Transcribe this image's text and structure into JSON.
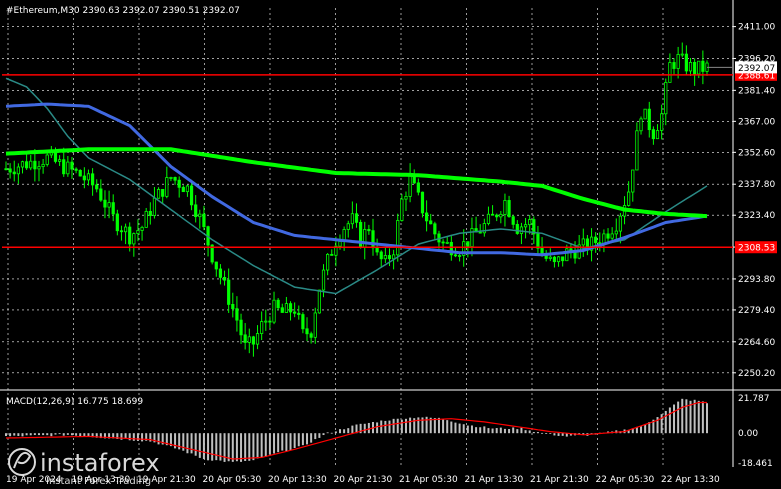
{
  "header": {
    "symbol_line": "#Ethereum,M30  2390.63 2392.07 2390.51 2392.07",
    "macd_line": "MACD(12,26,9) 16.775 18.699"
  },
  "watermark": {
    "brand": "instaforex",
    "tagline": "Instant Forex Trading"
  },
  "colors": {
    "background": "#000000",
    "grid": "#ffffff",
    "bull": "#00ff00",
    "bear": "#00ff00",
    "ma_fast": "#2a8a86",
    "ma_mid": "#4169e1",
    "ma_slow": "#00ff00",
    "level": "#ff0000",
    "macd_hist": "#c0c0c0",
    "macd_signal": "#ff0000"
  },
  "chart_data": [
    {
      "type": "candlestick",
      "price_axis": {
        "ticks": [
          "2411.00",
          "2396.20",
          "2381.40",
          "2367.00",
          "2352.60",
          "2337.80",
          "2323.40",
          "2308.60",
          "2293.80",
          "2279.40",
          "2264.60",
          "2250.20"
        ],
        "ylim": [
          2245,
          2415
        ]
      },
      "time_axis": {
        "ticks": [
          "19 Apr 2024",
          "19 Apr 13:30",
          "19 Apr 21:30",
          "20 Apr 05:30",
          "20 Apr 13:30",
          "20 Apr 21:30",
          "21 Apr 05:30",
          "21 Apr 13:30",
          "21 Apr 21:30",
          "22 Apr 05:30",
          "22 Apr 13:30"
        ]
      },
      "current_price": {
        "label": "2392.07",
        "value": 2392.07
      },
      "levels": [
        {
          "label": "2388.61",
          "value": 2388.61
        },
        {
          "label": "2308.53",
          "value": 2308.53
        }
      ],
      "close_path": [
        [
          0,
          2345
        ],
        [
          6,
          2348
        ],
        [
          10,
          2350
        ],
        [
          14,
          2346
        ],
        [
          18,
          2342
        ],
        [
          22,
          2336
        ],
        [
          26,
          2322
        ],
        [
          30,
          2314
        ],
        [
          33,
          2318
        ],
        [
          36,
          2330
        ],
        [
          40,
          2341
        ],
        [
          44,
          2336
        ],
        [
          47,
          2322
        ],
        [
          50,
          2305
        ],
        [
          53,
          2290
        ],
        [
          56,
          2275
        ],
        [
          58,
          2262
        ],
        [
          60,
          2264
        ],
        [
          62,
          2272
        ],
        [
          65,
          2280
        ],
        [
          67,
          2278
        ],
        [
          70,
          2280
        ],
        [
          72,
          2268
        ],
        [
          74,
          2270
        ],
        [
          76,
          2290
        ],
        [
          78,
          2302
        ],
        [
          80,
          2312
        ],
        [
          82,
          2318
        ],
        [
          84,
          2321
        ],
        [
          86,
          2312
        ],
        [
          88,
          2318
        ],
        [
          90,
          2304
        ],
        [
          92,
          2301
        ],
        [
          94,
          2308
        ],
        [
          96,
          2330
        ],
        [
          98,
          2340
        ],
        [
          100,
          2331
        ],
        [
          102,
          2322
        ],
        [
          104,
          2315
        ],
        [
          106,
          2310
        ],
        [
          110,
          2308
        ],
        [
          114,
          2315
        ],
        [
          118,
          2322
        ],
        [
          121,
          2330
        ],
        [
          124,
          2318
        ],
        [
          127,
          2320
        ],
        [
          130,
          2305
        ],
        [
          133,
          2300
        ],
        [
          136,
          2306
        ],
        [
          139,
          2308
        ],
        [
          142,
          2310
        ],
        [
          145,
          2314
        ],
        [
          148,
          2320
        ],
        [
          151,
          2335
        ],
        [
          154,
          2372
        ],
        [
          157,
          2362
        ],
        [
          159,
          2370
        ],
        [
          161,
          2393
        ],
        [
          163,
          2396
        ],
        [
          165,
          2393
        ],
        [
          167,
          2391
        ],
        [
          170,
          2392
        ]
      ],
      "ma_slow_path": [
        [
          0,
          2352
        ],
        [
          20,
          2354
        ],
        [
          40,
          2354
        ],
        [
          60,
          2348
        ],
        [
          80,
          2343
        ],
        [
          100,
          2342
        ],
        [
          120,
          2339
        ],
        [
          130,
          2337
        ],
        [
          140,
          2331
        ],
        [
          150,
          2326
        ],
        [
          160,
          2324
        ],
        [
          170,
          2323
        ]
      ],
      "ma_mid_path": [
        [
          0,
          2374
        ],
        [
          10,
          2375
        ],
        [
          20,
          2374
        ],
        [
          30,
          2365
        ],
        [
          40,
          2346
        ],
        [
          50,
          2332
        ],
        [
          60,
          2320
        ],
        [
          70,
          2314
        ],
        [
          80,
          2312
        ],
        [
          90,
          2310
        ],
        [
          100,
          2308
        ],
        [
          110,
          2306
        ],
        [
          120,
          2306
        ],
        [
          130,
          2305
        ],
        [
          140,
          2307
        ],
        [
          150,
          2313
        ],
        [
          160,
          2320
        ],
        [
          170,
          2323
        ]
      ],
      "ma_fast_path": [
        [
          0,
          2387
        ],
        [
          5,
          2383
        ],
        [
          10,
          2373
        ],
        [
          15,
          2360
        ],
        [
          20,
          2350
        ],
        [
          30,
          2340
        ],
        [
          40,
          2326
        ],
        [
          50,
          2312
        ],
        [
          60,
          2300
        ],
        [
          70,
          2290
        ],
        [
          80,
          2287
        ],
        [
          90,
          2298
        ],
        [
          100,
          2310
        ],
        [
          110,
          2315
        ],
        [
          120,
          2317
        ],
        [
          130,
          2315
        ],
        [
          140,
          2308
        ],
        [
          150,
          2312
        ],
        [
          160,
          2325
        ],
        [
          170,
          2337
        ]
      ],
      "macd": {
        "ticks": [
          "21.787",
          "0.00",
          "-18.461"
        ],
        "ylim": [
          -18.461,
          21.787
        ],
        "histogram_path": [
          [
            0,
            -2
          ],
          [
            15,
            -1
          ],
          [
            25,
            -3
          ],
          [
            35,
            -5
          ],
          [
            42,
            -10
          ],
          [
            48,
            -16
          ],
          [
            55,
            -18
          ],
          [
            60,
            -17
          ],
          [
            66,
            -12
          ],
          [
            72,
            -8
          ],
          [
            78,
            0
          ],
          [
            85,
            5
          ],
          [
            92,
            8
          ],
          [
            100,
            10
          ],
          [
            106,
            9
          ],
          [
            112,
            5
          ],
          [
            118,
            3
          ],
          [
            125,
            3
          ],
          [
            130,
            0
          ],
          [
            136,
            -2
          ],
          [
            142,
            -1
          ],
          [
            150,
            2
          ],
          [
            155,
            5
          ],
          [
            160,
            14
          ],
          [
            164,
            21
          ],
          [
            168,
            20
          ],
          [
            171,
            18
          ]
        ],
        "signal_path": [
          [
            0,
            -3
          ],
          [
            20,
            -2
          ],
          [
            35,
            -4
          ],
          [
            45,
            -10
          ],
          [
            55,
            -16
          ],
          [
            62,
            -15
          ],
          [
            70,
            -10
          ],
          [
            80,
            -3
          ],
          [
            90,
            4
          ],
          [
            100,
            8
          ],
          [
            108,
            9
          ],
          [
            116,
            7
          ],
          [
            124,
            4
          ],
          [
            132,
            1
          ],
          [
            140,
            -1
          ],
          [
            150,
            1
          ],
          [
            158,
            8
          ],
          [
            164,
            16
          ],
          [
            168,
            19
          ],
          [
            171,
            19
          ]
        ]
      }
    }
  ]
}
